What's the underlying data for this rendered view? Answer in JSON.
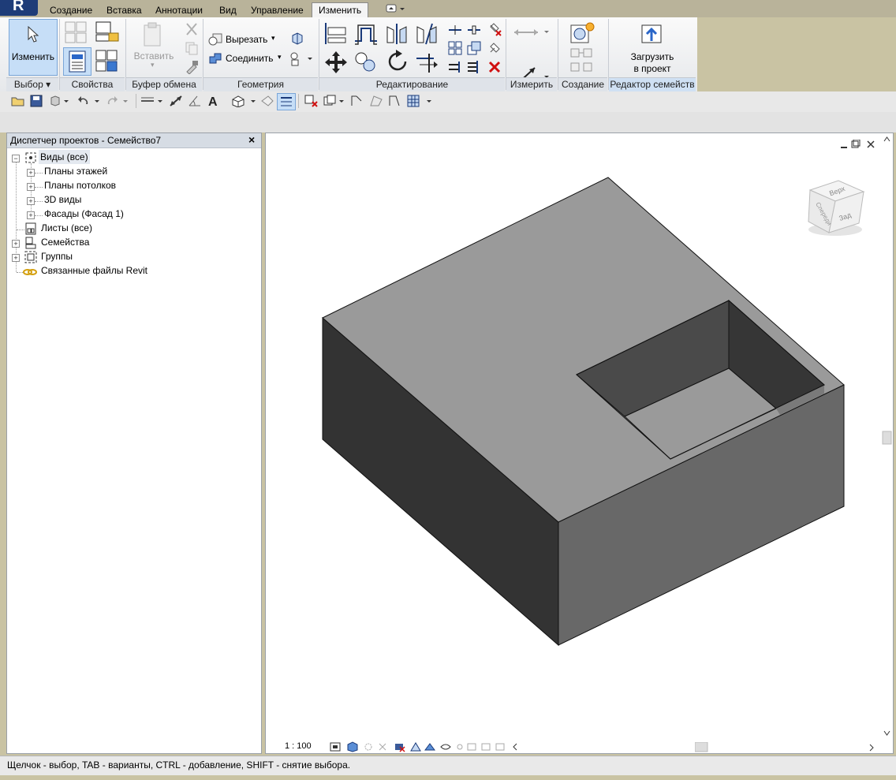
{
  "app": {
    "logo": "R"
  },
  "tabs": [
    {
      "label": "Создание"
    },
    {
      "label": "Вставка"
    },
    {
      "label": "Аннотации"
    },
    {
      "label": "Вид"
    },
    {
      "label": "Управление"
    },
    {
      "label": "Изменить",
      "active": true
    }
  ],
  "ribbon": {
    "modify_label": "Изменить",
    "paste_label": "Вставить",
    "cut_label": "Вырезать",
    "join_label": "Соединить",
    "load_label_line1": "Загрузить",
    "load_label_line2": "в проект",
    "panels": {
      "select": "Выбор",
      "properties": "Свойства",
      "clipboard": "Буфер обмена",
      "geometry": "Геометрия",
      "modify": "Редактирование",
      "measure": "Измерить",
      "create": "Создание",
      "family_editor": "Редактор семейств"
    }
  },
  "browser": {
    "title": "Диспетчер проектов - Семейство7",
    "close": "×",
    "items": [
      {
        "label": "Виды (все)"
      },
      {
        "label": "Планы этажей"
      },
      {
        "label": "Планы потолков"
      },
      {
        "label": "3D виды"
      },
      {
        "label": "Фасады (Фасад 1)"
      },
      {
        "label": "Листы (все)"
      },
      {
        "label": "Семейства"
      },
      {
        "label": "Группы"
      },
      {
        "label": "Связанные файлы Revit"
      }
    ]
  },
  "viewport": {
    "scale": "1 : 100",
    "viewcube_faces": {
      "top": "Верх",
      "front": "Спереди",
      "back": "Зад"
    }
  },
  "status": {
    "text": "Щелчок - выбор, TAB - варианты, CTRL - добавление, SHIFT - снятие выбора."
  },
  "colors": {
    "ribbon_accent": "#c6def7",
    "box_top": "#9a9a9a",
    "box_left": "#333333",
    "box_right": "#686868"
  }
}
